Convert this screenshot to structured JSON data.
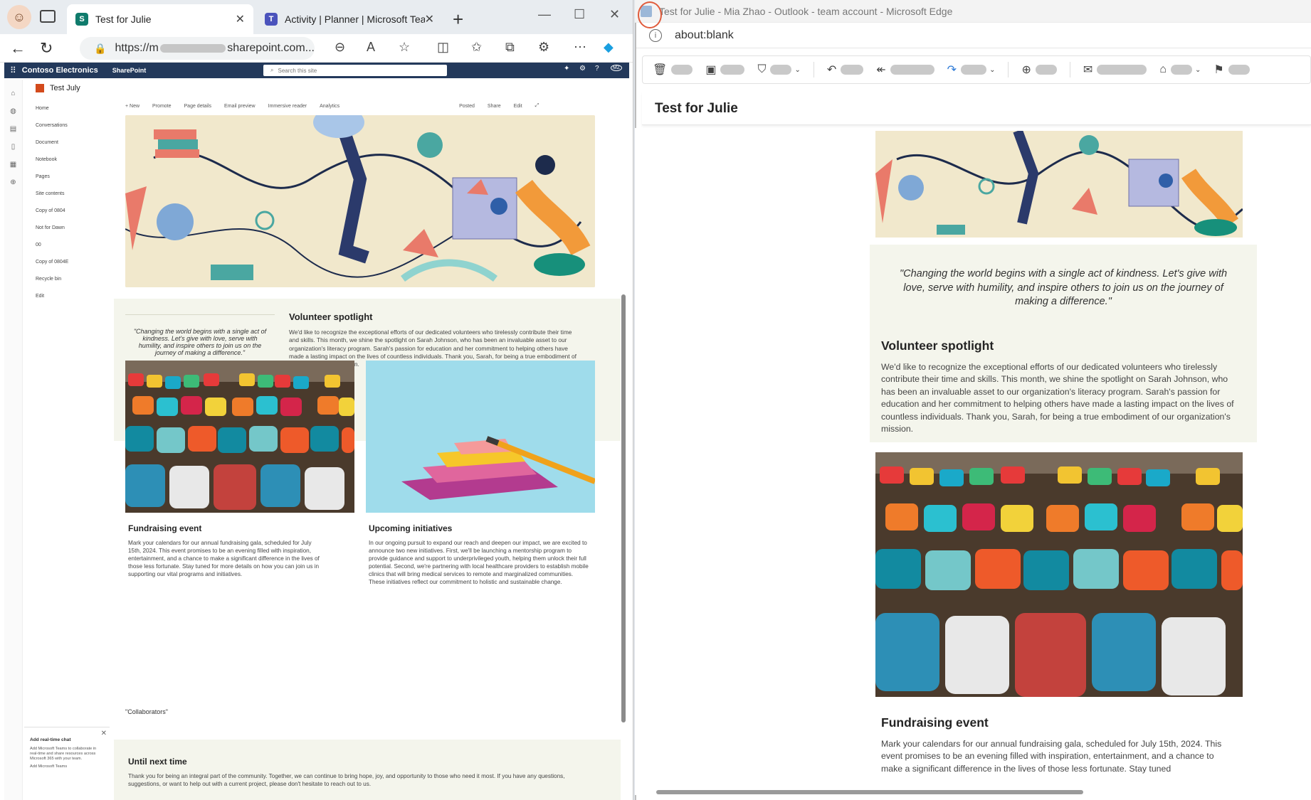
{
  "left": {
    "tabs": [
      {
        "label": "Test for Julie",
        "active": true
      },
      {
        "label": "Activity | Planner | Microsoft Team",
        "active": false
      }
    ],
    "url": {
      "prefix": "https://m",
      "suffix": "sharepoint.com..."
    },
    "suite": {
      "org": "Contoso Electronics",
      "app": "SharePoint",
      "search_placeholder": "Search this site"
    },
    "site_title": "Test July",
    "nav": [
      "Home",
      "Conversations",
      "Document",
      "Notebook",
      "Pages",
      "Site contents",
      "Copy of 0804",
      "Not for Dawn",
      "00",
      "Copy of 0804E",
      "Recycle bin",
      "Edit"
    ],
    "cmd": {
      "new": "+ New",
      "promote": "Promote",
      "page_details": "Page details",
      "email_preview": "Email preview",
      "immersive_reader": "Immersive reader",
      "analytics": "Analytics",
      "posted": "Posted",
      "share": "Share",
      "edit": "Edit"
    },
    "quote": "\"Changing the world begins with a single act of kindness. Let's give with love, serve with humility, and inspire others to join us on the journey of making a difference.\"",
    "volunteer": {
      "title": "Volunteer spotlight",
      "body": "We'd like to recognize the exceptional efforts of our dedicated volunteers who tirelessly contribute their time and skills. This month, we shine the spotlight on Sarah Johnson, who has been an invaluable asset to our organization's literacy program. Sarah's passion for education and her commitment to helping others have made a lasting impact on the lives of countless individuals. Thank you, Sarah, for being a true embodiment of our organization's mission."
    },
    "fundraising": {
      "title": "Fundraising event",
      "body": "Mark your calendars for our annual fundraising gala, scheduled for July 15th, 2024. This event promises to be an evening filled with inspiration, entertainment, and a chance to make a significant difference in the lives of those less fortunate. Stay tuned for more details on how you can join us in supporting our vital programs and initiatives."
    },
    "upcoming": {
      "title": "Upcoming initiatives",
      "body": "In our ongoing pursuit to expand our reach and deepen our impact, we are excited to announce two new initiatives. First, we'll be launching a mentorship program to provide guidance and support to underprivileged youth, helping them unlock their full potential. Second, we're partnering with local healthcare providers to establish mobile clinics that will bring medical services to remote and marginalized communities. These initiatives reflect our commitment to holistic and sustainable change."
    },
    "collaborators": "\"Collaborators\"",
    "until": {
      "title": "Until next time",
      "body": "Thank you for being an integral part of the community. Together, we can continue to bring hope, joy, and opportunity to those who need it most. If you have any questions, suggestions, or want to help out with a current project, please don't hesitate to reach out to us."
    },
    "teams_card": {
      "title": "Add real-time chat",
      "body": "Add Microsoft Teams to collaborate in real-time and share resources across Microsoft 365 with your team.",
      "link": "Add Microsoft Teams"
    }
  },
  "right": {
    "window_title": "Test for Julie - Mia Zhao - Outlook - team account - Microsoft Edge",
    "address": "about:blank",
    "subject": "Test for Julie",
    "quote": "\"Changing the world begins with a single act of kindness. Let's give with love, serve with humility, and inspire others to join us on the journey of making a difference.\"",
    "volunteer": {
      "title": "Volunteer spotlight",
      "body": "We'd like to recognize the exceptional efforts of our dedicated volunteers who tirelessly contribute their time and skills. This month, we shine the spotlight on Sarah Johnson, who has been an invaluable asset to our organization's literacy program. Sarah's passion for education and her commitment to helping others have made a lasting impact on the lives of countless individuals. Thank you, Sarah, for being a true embodiment of our organization's mission."
    },
    "fundraising": {
      "title": "Fundraising event",
      "body": "Mark your calendars for our annual fundraising gala, scheduled for July 15th, 2024. This event promises to be an evening filled with inspiration, entertainment, and a chance to make a significant difference in the lives of those less fortunate. Stay tuned"
    }
  }
}
